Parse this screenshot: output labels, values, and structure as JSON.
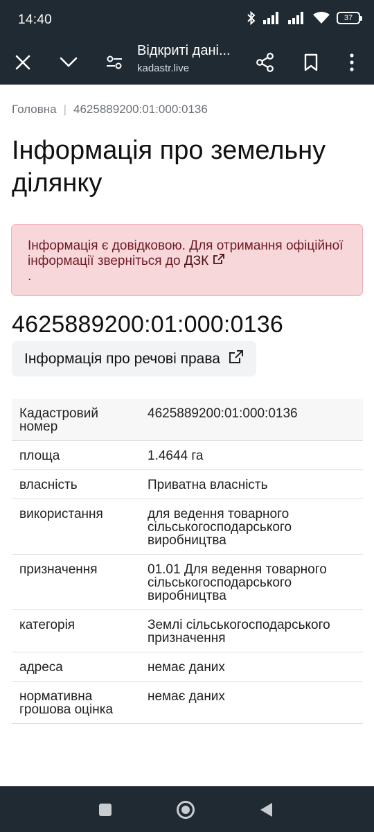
{
  "status_bar": {
    "time": "14:40",
    "battery": "37",
    "icons": [
      "bluetooth-icon",
      "signal-icon",
      "signal-icon",
      "wifi-icon",
      "battery-icon"
    ]
  },
  "browser": {
    "title": "Відкриті дані...",
    "url": "kadastr.live",
    "icons": [
      "close-icon",
      "chevron-down-icon",
      "page-settings-icon",
      "share-icon",
      "bookmark-icon",
      "more-vert-icon"
    ]
  },
  "breadcrumb": {
    "home": "Головна",
    "separator": "|",
    "current": "4625889200:01:000:0136"
  },
  "page_title": "Інформація про земельну ділянку",
  "alert": {
    "text": "Інформація є довідковою. Для отримання офіційної інформації зверніться до",
    "link": "ДЗК",
    "suffix": "."
  },
  "cadastral_number": "4625889200:01:000:0136",
  "rights_button": "Інформація про речові права",
  "table": [
    {
      "key": "Кадастровий номер",
      "value": "4625889200:01:000:0136"
    },
    {
      "key": "площа",
      "value": "1.4644 га"
    },
    {
      "key": "власність",
      "value": "Приватна власність"
    },
    {
      "key": "використання",
      "value": "для ведення товарного сільськогосподарського виробництва"
    },
    {
      "key": "призначення",
      "value": "01.01 Для ведення товарного сільськогосподарського виробництва"
    },
    {
      "key": "категорія",
      "value": "Землі сільськогосподарського призначення"
    },
    {
      "key": "адреса",
      "value": "немає даних"
    },
    {
      "key": "нормативна грошова оцінка",
      "value": "немає даних"
    }
  ],
  "colors": {
    "chrome": "#1f2a33",
    "alert_bg": "#f7d7da",
    "alert_text": "#6d1a23"
  }
}
